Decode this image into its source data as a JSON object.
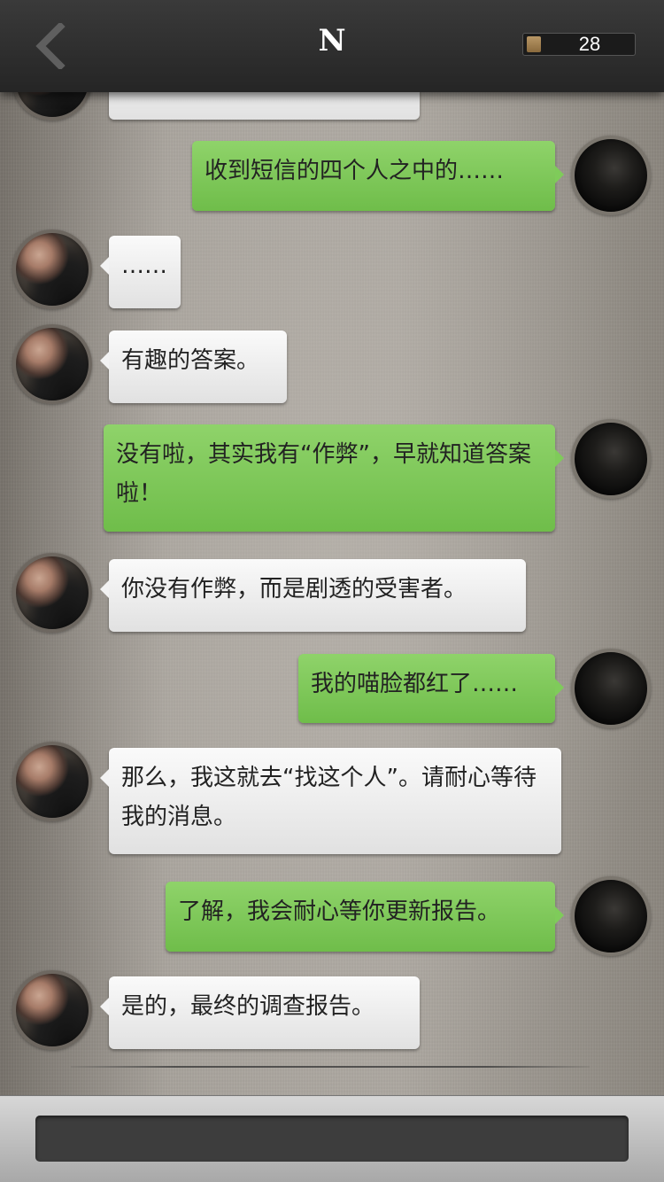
{
  "header": {
    "title": "N",
    "coin_count": "28"
  },
  "messages": [
    {
      "side": "left",
      "text": ""
    },
    {
      "side": "right",
      "text": "收到短信的四个人之中的……"
    },
    {
      "side": "left",
      "text": "……"
    },
    {
      "side": "left",
      "text": "有趣的答案。"
    },
    {
      "side": "right",
      "text": "没有啦，其实我有“作弊”，早就知道答案啦！"
    },
    {
      "side": "left",
      "text": "你没有作弊，而是剧透的受害者。"
    },
    {
      "side": "right",
      "text": "我的喵脸都红了……"
    },
    {
      "side": "left",
      "text": "那么，我这就去“找这个人”。请耐心等待我的消息。"
    },
    {
      "side": "right",
      "text": "了解，我会耐心等你更新报告。"
    },
    {
      "side": "left",
      "text": "是的，最终的调查报告。"
    }
  ],
  "colors": {
    "bubble_right": "#7fcb5a",
    "bubble_left": "#f2f2f2",
    "header_bg": "#2e2e2e"
  },
  "icons": {
    "back": "chevron-left-icon",
    "coin": "coin-icon"
  }
}
